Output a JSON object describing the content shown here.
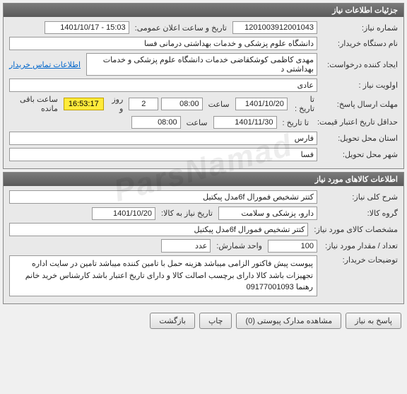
{
  "watermark": "ParsNamad",
  "panel1": {
    "title": "جزئیات اطلاعات نیاز",
    "need_number_label": "شماره نیاز:",
    "need_number": "1201003912001043",
    "announce_label": "تاریخ و ساعت اعلان عمومی:",
    "announce_value": "15:03 - 1401/10/17",
    "buyer_org_label": "نام دستگاه خریدار:",
    "buyer_org": "دانشگاه علوم پزشکی و خدمات بهداشتی درمانی فسا",
    "creator_label": "ایجاد کننده درخواست:",
    "creator": "مهدی  کاظمی کوشکقاضی خدمات دانشگاه علوم پزشکی و خدمات بهداشتی د",
    "contact_link": "اطلاعات تماس خریدار",
    "priority_label": "اولویت نیاز :",
    "priority": "عادی",
    "deadline_label": "مهلت ارسال پاسخ:",
    "to_date_label": "تا تاریخ :",
    "deadline_date": "1401/10/20",
    "time_label": "ساعت",
    "deadline_time": "08:00",
    "days_remaining": "2",
    "days_text": "روز و",
    "time_remaining": "16:53:17",
    "remaining_text": "ساعت باقی مانده",
    "validity_label": "حداقل تاریخ اعتبار قیمت:",
    "validity_date": "1401/11/30",
    "validity_time": "08:00",
    "province_label": "استان محل تحویل:",
    "province": "فارس",
    "city_label": "شهر محل تحویل:",
    "city": "فسا"
  },
  "panel2": {
    "title": "اطلاعات کالاهای مورد نیاز",
    "general_desc_label": "شرح کلی نیاز:",
    "general_desc": "کتتر تشخیص فمورال 6fمدل پیکتیل",
    "group_label": "گروه کالا:",
    "group": "دارو، پزشکی و سلامت",
    "need_date_label": "تاریخ نیاز به کالا:",
    "need_date": "1401/10/20",
    "spec_label": "مشخصات کالای مورد نیاز:",
    "spec": "کتتر تشخیص فمورال 6fمدل پیکتیل",
    "qty_label": "تعداد / مقدار مورد نیاز:",
    "qty": "100",
    "unit_label": "واحد شمارش:",
    "unit": "عدد",
    "notes_label": "توضیحات خریدار:",
    "notes": "پیوست پیش فاکتور الزامی میباشد هزینه حمل با تامین کننده میباشد تامین در سایت اداره تجهیزات باشد کالا دارای برچسب اصالت کالا و دارای تاریخ اعتبار باشد کارشناس خرید خانم رهنما 09177001093"
  },
  "buttons": {
    "reply": "پاسخ به نیاز",
    "attachments": "مشاهده مدارک پیوستی (0)",
    "print": "چاپ",
    "back": "بازگشت"
  }
}
